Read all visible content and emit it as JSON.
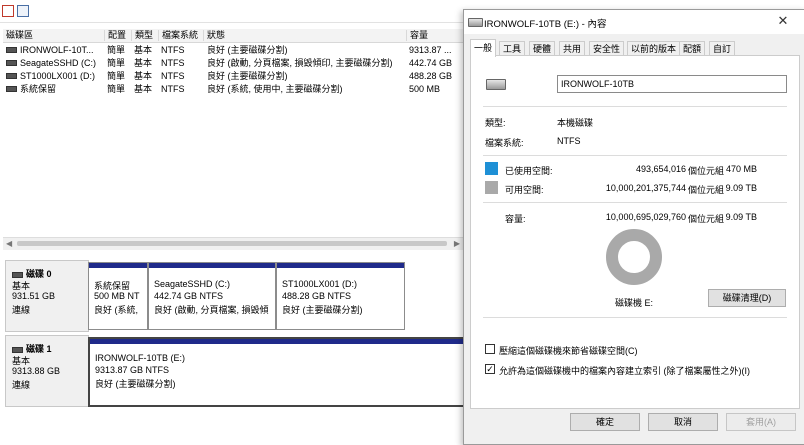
{
  "volume_list": {
    "headers": [
      "磁碟區",
      "配置",
      "類型",
      "檔案系統",
      "狀態",
      "容量"
    ],
    "rows": [
      {
        "name": "IRONWOLF-10T...",
        "layout": "簡單",
        "type": "基本",
        "fs": "NTFS",
        "status": "良好 (主要磁碟分割)",
        "capacity": "9313.87 ..."
      },
      {
        "name": "SeagateSSHD (C:)",
        "layout": "簡單",
        "type": "基本",
        "fs": "NTFS",
        "status": "良好 (啟動, 分頁檔案, 損毀傾印, 主要磁碟分割)",
        "capacity": "442.74 GB"
      },
      {
        "name": "ST1000LX001 (D:)",
        "layout": "簡單",
        "type": "基本",
        "fs": "NTFS",
        "status": "良好 (主要磁碟分割)",
        "capacity": "488.28 GB"
      },
      {
        "name": "系統保留",
        "layout": "簡單",
        "type": "基本",
        "fs": "NTFS",
        "status": "良好 (系統, 使用中, 主要磁碟分割)",
        "capacity": "500 MB"
      }
    ]
  },
  "disks": [
    {
      "label": "磁碟 0",
      "type": "基本",
      "size": "931.51 GB",
      "status": "連線",
      "partitions": [
        {
          "name": "系統保留",
          "size": "500 MB NT",
          "status": "良好 (系統,"
        },
        {
          "name": "SeagateSSHD  (C:)",
          "size": "442.74 GB NTFS",
          "status": "良好 (啟動, 分頁檔案, 損毀傾"
        },
        {
          "name": "ST1000LX001  (D:)",
          "size": "488.28 GB NTFS",
          "status": "良好 (主要磁碟分割)"
        }
      ]
    },
    {
      "label": "磁碟 1",
      "type": "基本",
      "size": "9313.88 GB",
      "status": "連線",
      "partitions": [
        {
          "name": "IRONWOLF-10TB  (E:)",
          "size": "9313.87 GB NTFS",
          "status": "良好 (主要磁碟分割)"
        }
      ]
    }
  ],
  "dialog": {
    "title": "IRONWOLF-10TB (E:) - 內容",
    "close_glyph": "✕",
    "tabs": [
      "一般",
      "工具",
      "硬體",
      "共用",
      "安全性",
      "以前的版本",
      "配額",
      "自訂"
    ],
    "volume_label": "IRONWOLF-10TB",
    "type_label": "類型:",
    "type_value": "本機磁碟",
    "fs_label": "檔案系統:",
    "fs_value": "NTFS",
    "used_label": "已使用空間:",
    "used_bytes": "493,654,016",
    "used_unit": "個位元組",
    "used_size": "470 MB",
    "free_label": "可用空間:",
    "free_bytes": "10,000,201,375,744",
    "free_unit": "個位元組",
    "free_size": "9.09 TB",
    "cap_label": "容量:",
    "cap_bytes": "10,000,695,029,760",
    "cap_unit": "個位元組",
    "cap_size": "9.09 TB",
    "used_fraction": 5e-05,
    "drive_label": "磁碟機 E:",
    "cleanup_button": "磁碟清理(D)",
    "compress_label": "壓縮這個磁碟機來節省磁碟空間(C)",
    "compress_checked": false,
    "index_label": "允許為這個磁碟機中的檔案內容建立索引 (除了檔案屬性之外)(I)",
    "index_checked": true,
    "ok_button": "確定",
    "cancel_button": "取消",
    "apply_button": "套用(A)"
  },
  "colors": {
    "used": "#1e90d6",
    "free": "#a9a9a9",
    "partition_bar": "#1f2a8a"
  }
}
